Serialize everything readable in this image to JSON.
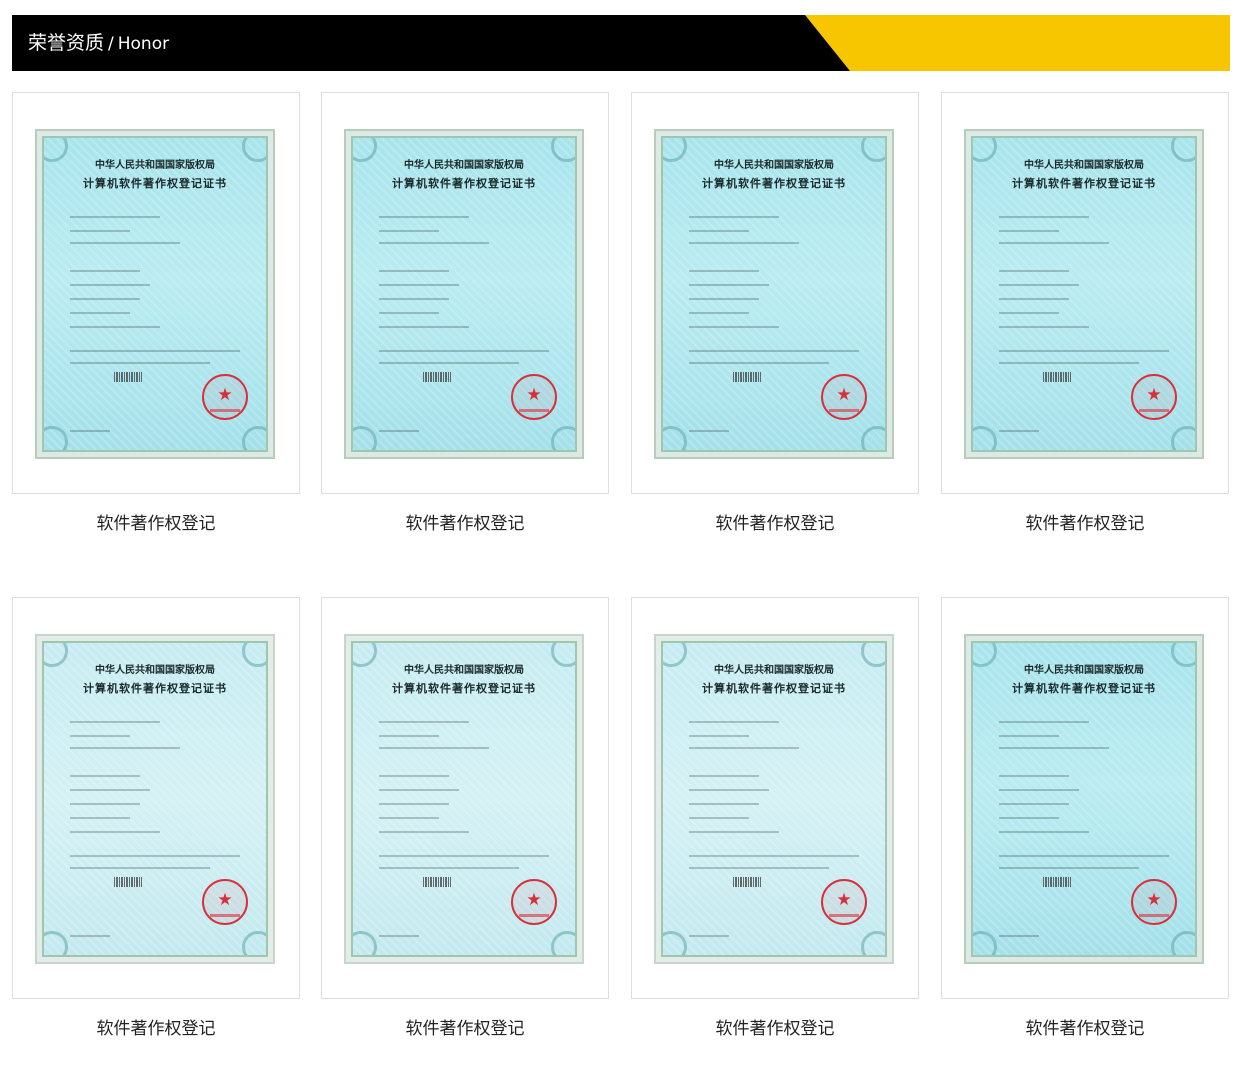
{
  "header": {
    "title_cn": "荣誉资质",
    "separator": "/",
    "title_en": "Honor"
  },
  "colors": {
    "header_background": "#000000",
    "header_accent": "#f7c600",
    "caption_text": "#222222"
  },
  "certificates": [
    {
      "caption": "软件著作权登记",
      "header_line": "中华人民共和国国家版权局",
      "title_line": "计算机软件著作权登记证书"
    },
    {
      "caption": "软件著作权登记",
      "header_line": "中华人民共和国国家版权局",
      "title_line": "计算机软件著作权登记证书"
    },
    {
      "caption": "软件著作权登记",
      "header_line": "中华人民共和国国家版权局",
      "title_line": "计算机软件著作权登记证书"
    },
    {
      "caption": "软件著作权登记",
      "header_line": "中华人民共和国国家版权局",
      "title_line": "计算机软件著作权登记证书"
    },
    {
      "caption": "软件著作权登记",
      "header_line": "中华人民共和国国家版权局",
      "title_line": "计算机软件著作权登记证书"
    },
    {
      "caption": "软件著作权登记",
      "header_line": "中华人民共和国国家版权局",
      "title_line": "计算机软件著作权登记证书"
    },
    {
      "caption": "软件著作权登记",
      "header_line": "中华人民共和国国家版权局",
      "title_line": "计算机软件著作权登记证书"
    },
    {
      "caption": "软件著作权登记",
      "header_line": "中华人民共和国国家版权局",
      "title_line": "计算机软件著作权登记证书"
    }
  ]
}
